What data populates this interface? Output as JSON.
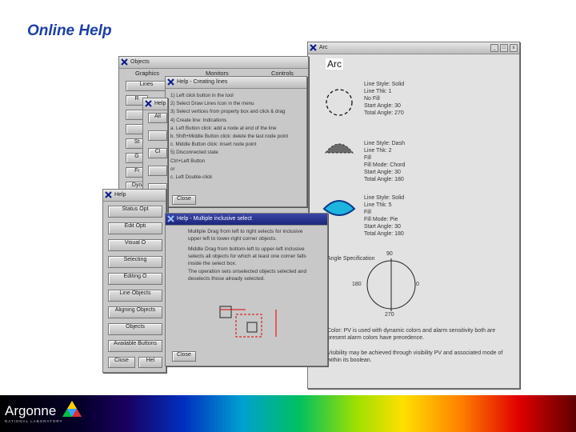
{
  "slide": {
    "title": "Online Help"
  },
  "objects_window": {
    "title": "Objects",
    "menus": [
      "Graphics",
      "Monitors",
      "Controls"
    ],
    "buttons": [
      "Lines",
      "R",
      "",
      "",
      "St",
      "G",
      "Fi",
      "Dyna"
    ]
  },
  "help_creating_lines": {
    "title": "Help - Creating lines",
    "lines": [
      "1) Left click button in the tool",
      "2) Select Draw Lines Icon in the menu",
      "3) Select vertices from property box and click & drag",
      "4) Create line: Indications",
      "   a. Left Button click: add a node at end of the line",
      "   b. Shift+Middle Button click: delete the last node point",
      "   c. Middle Button click: insert node point",
      "5) Disconnected state",
      "   Ctrl+Left Button",
      "   or",
      "   c. Left Double-click"
    ],
    "close": "Close"
  },
  "help_mid_window": {
    "title": "Help",
    "buttons": [
      "All",
      "",
      "Cl",
      "",
      "",
      "",
      ""
    ]
  },
  "help_list_window": {
    "title": "Help",
    "buttons": [
      "Status Opt",
      "Edit Opti",
      "Visual O",
      "Selecting",
      "Editing O",
      "Line Objects",
      "Aligning Objects",
      "Objects",
      "Available Buttons"
    ],
    "close": "Close",
    "help2": "Hel"
  },
  "help_multiple_select": {
    "title": "Help - Multiple inclusive select",
    "paragraphs": [
      "Mulitple Drag from left to right selects for inclusive upper left to lower-right corner objects.",
      "Middle Drag from bottom-left to upper-left inclusive selects all objects for which at least one corner falls inside the select box.",
      "The operation sets unselected objects selected and deselects those already selected."
    ],
    "close": "Close"
  },
  "arc_window": {
    "title": "Arc",
    "heading": "Arc",
    "props": [
      [
        "Line Style: Solid",
        "Line Thk: 1",
        "No Fill",
        "Start Angle: 30",
        "Total Angle: 270"
      ],
      [
        "Line Style: Dash",
        "Line Thk: 2",
        "Fill",
        "Fill Mode: Chord",
        "Start Angle: 30",
        "Total Angle: 180"
      ],
      [
        "Line Style: Solid",
        "Line Thk: 5",
        "Fill",
        "Fill Mode: Pie",
        "Start Angle: 30",
        "Total Angle: 180"
      ]
    ],
    "angle_spec": "Angle Specification",
    "angles": {
      "top": "90",
      "left": "180",
      "right": "0",
      "bottom": "270"
    },
    "note1": "Color: PV is used with dynamic colors and alarm sensitivity both are present alarm colors have precedence.",
    "note2": "Visibility may be achieved through visibility PV and associated mode of within its boolean."
  },
  "footer": {
    "logo": "Argonne",
    "subtitle": "NATIONAL LABORATORY"
  },
  "colors": {
    "title": "#1a3fa8",
    "active_titlebar": "#1c267a",
    "chord_fill": "#6a6a6a",
    "pie_fill": "#1db5e0"
  }
}
